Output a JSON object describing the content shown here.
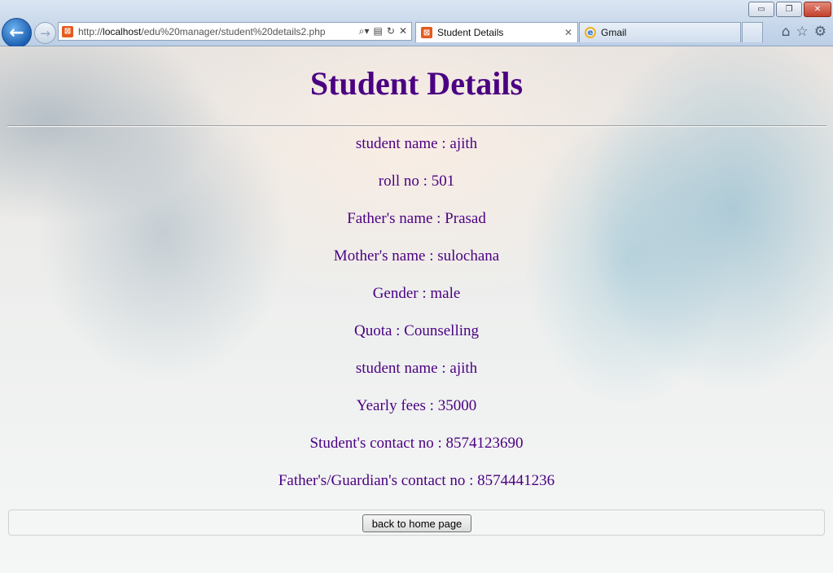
{
  "browser": {
    "url_prefix": "http://",
    "url_host": "localhost",
    "url_path": "/edu%20manager/student%20details2.php",
    "tabs": [
      {
        "label": "Student Details",
        "active": true,
        "icon": "xampp-icon"
      },
      {
        "label": "Gmail",
        "active": false,
        "icon": "ie-icon"
      }
    ],
    "window_buttons": {
      "minimize": "▭",
      "restore": "❐",
      "close": "✕"
    }
  },
  "page": {
    "title": "Student Details",
    "title_color": "#4b0082",
    "details": [
      "student name : ajith",
      "roll no : 501",
      "Father's name : Prasad",
      "Mother's name : sulochana",
      "Gender : male",
      "Quota : Counselling",
      "student name : ajith",
      "Yearly fees : 35000",
      "Student's contact no : 8574123690",
      "Father's/Guardian's contact no : 8574441236"
    ],
    "home_button_label": "back to home page"
  }
}
